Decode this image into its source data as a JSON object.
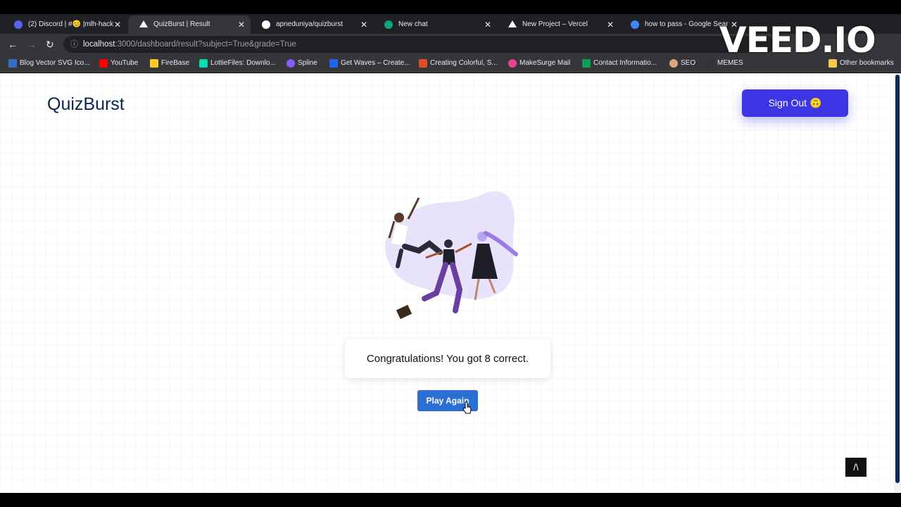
{
  "browser": {
    "tabs": [
      {
        "label": "(2) Discord | #😊 |mlh-hack",
        "favicon_color": "#5865f2"
      },
      {
        "label": "QuizBurst | Result",
        "favicon_color": "#ffffff"
      },
      {
        "label": "apneduniya/quizburst",
        "favicon_color": "#ffffff"
      },
      {
        "label": "New chat",
        "favicon_color": "#10a37f"
      },
      {
        "label": "New Project – Vercel",
        "favicon_color": "#ffffff"
      },
      {
        "label": "how to pass - Google Sear",
        "favicon_color": "#4285f4"
      }
    ],
    "url_host": "localhost",
    "url_rest": ":3000/dashboard/result?subject=True&grade=True",
    "bookmarks": [
      {
        "label": "Blog Vector SVG Ico...",
        "color": "#3b6cc4"
      },
      {
        "label": "YouTube",
        "color": "#ff0000"
      },
      {
        "label": "FireBase",
        "color": "#ffca28"
      },
      {
        "label": "LottieFiles: Downlo...",
        "color": "#00ddb3"
      },
      {
        "label": "Spline",
        "color": "#8a5cf6"
      },
      {
        "label": "Get Waves – Create...",
        "color": "#2563eb"
      },
      {
        "label": "Creating Colorful, S...",
        "color": "#e34c26"
      },
      {
        "label": "MakeSurge Mail",
        "color": "#e84393"
      },
      {
        "label": "Contact Informatio...",
        "color": "#0f9d58"
      },
      {
        "label": "SEO",
        "color": "#d9a77a"
      },
      {
        "label": "MEMES",
        "color": "#333333"
      }
    ],
    "other_bookmarks": "Other bookmarks",
    "watermark": "VEED.IO"
  },
  "page": {
    "logo": "QuizBurst",
    "sign_out_label": "Sign Out 🙃",
    "result_text": "Congratulations! You got 8 correct.",
    "play_again_label": "Play Again",
    "scroll_top_label": "/\\"
  }
}
